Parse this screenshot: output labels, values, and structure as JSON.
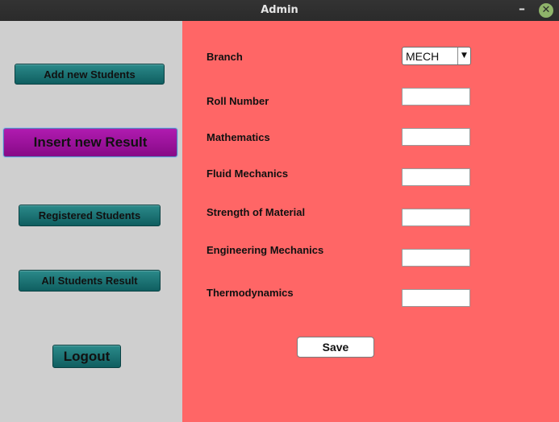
{
  "window": {
    "title": "Admin",
    "minimize_glyph": "–",
    "close_glyph": "✕"
  },
  "sidebar": {
    "add_students": "Add new Students",
    "insert_result": "Insert new Result",
    "registered_students": "Registered Students",
    "all_results": "All Students Result",
    "logout": "Logout"
  },
  "form": {
    "branch_label": "Branch",
    "branch_value": "MECH",
    "branch_arrow": "▼",
    "roll_label": "Roll Number",
    "math_label": "Mathematics",
    "fluid_label": "Fluid Mechanics",
    "strength_label": "Strength of Material",
    "engmech_label": "Engineering Mechanics",
    "thermo_label": "Thermodynamics",
    "save_label": "Save"
  },
  "colors": {
    "main_bg": "#ff6666",
    "sidebar_bg": "#cfcfcf",
    "nav_button": "#1a7070",
    "active_button": "#9c129c"
  }
}
